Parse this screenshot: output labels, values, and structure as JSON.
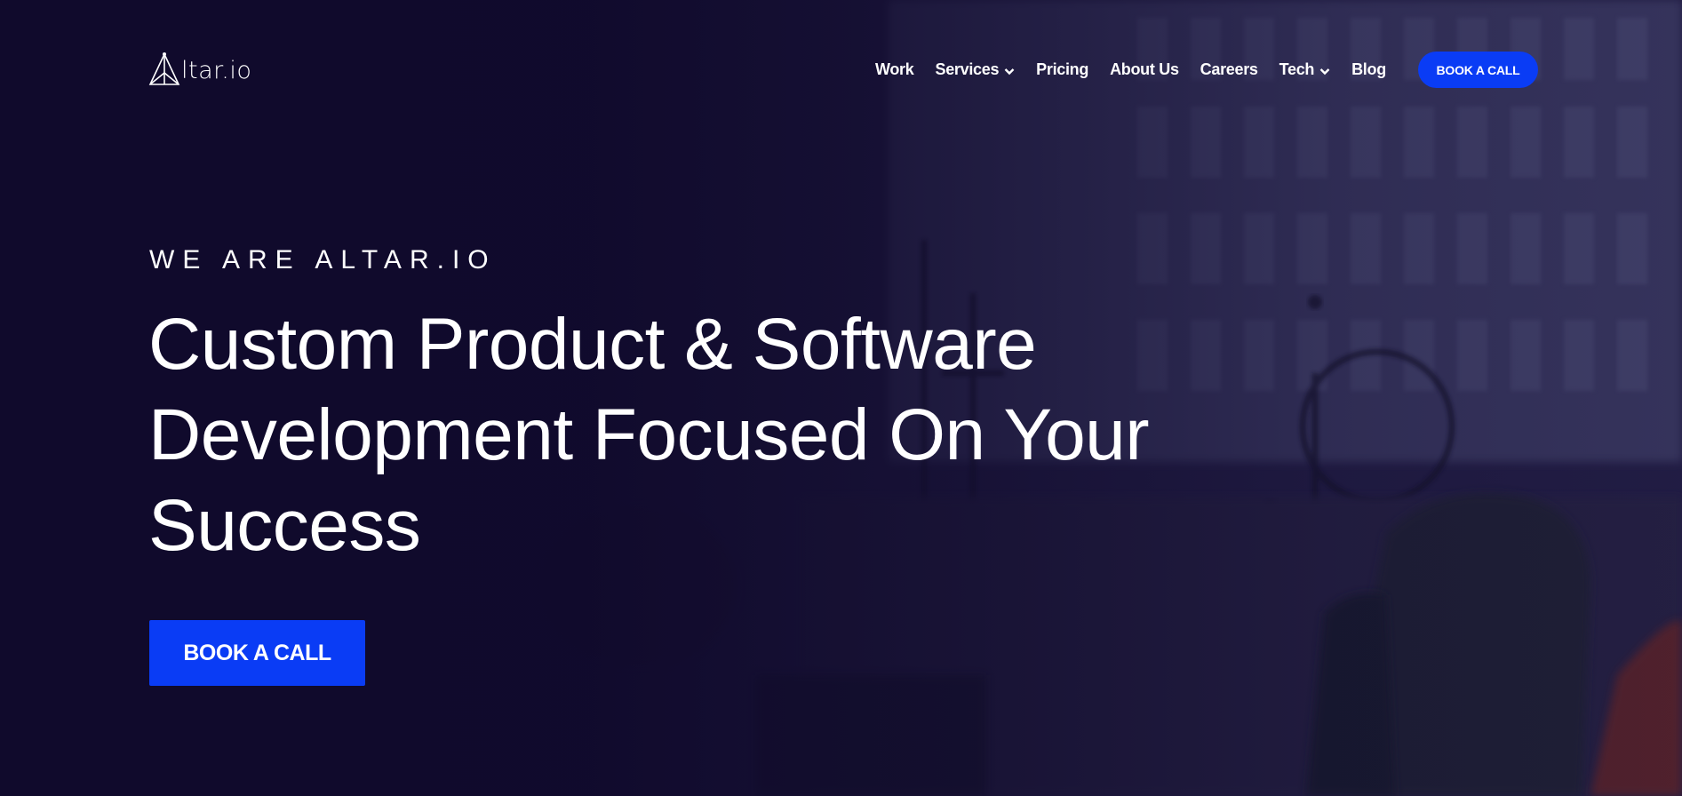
{
  "brand": {
    "logo_text": "ltar.io"
  },
  "nav": {
    "items": [
      {
        "label": "Work",
        "dropdown": false
      },
      {
        "label": "Services",
        "dropdown": true
      },
      {
        "label": "Pricing",
        "dropdown": false
      },
      {
        "label": "About Us",
        "dropdown": false
      },
      {
        "label": "Careers",
        "dropdown": false
      },
      {
        "label": "Tech",
        "dropdown": true
      },
      {
        "label": "Blog",
        "dropdown": false
      }
    ],
    "cta_label": "BOOK A CALL"
  },
  "hero": {
    "eyebrow": "WE ARE ALTAR.IO",
    "headline_line1": "Custom Product & Software",
    "headline_line2": "Development Focused On Your",
    "headline_line3": "Success",
    "cta_label": "BOOK A CALL"
  },
  "colors": {
    "background": "#100a2c",
    "accent": "#0a3cf5",
    "text": "#ffffff"
  },
  "icons": {
    "logo": "triangle-a-logo-icon",
    "dropdown": "chevron-down-icon"
  }
}
